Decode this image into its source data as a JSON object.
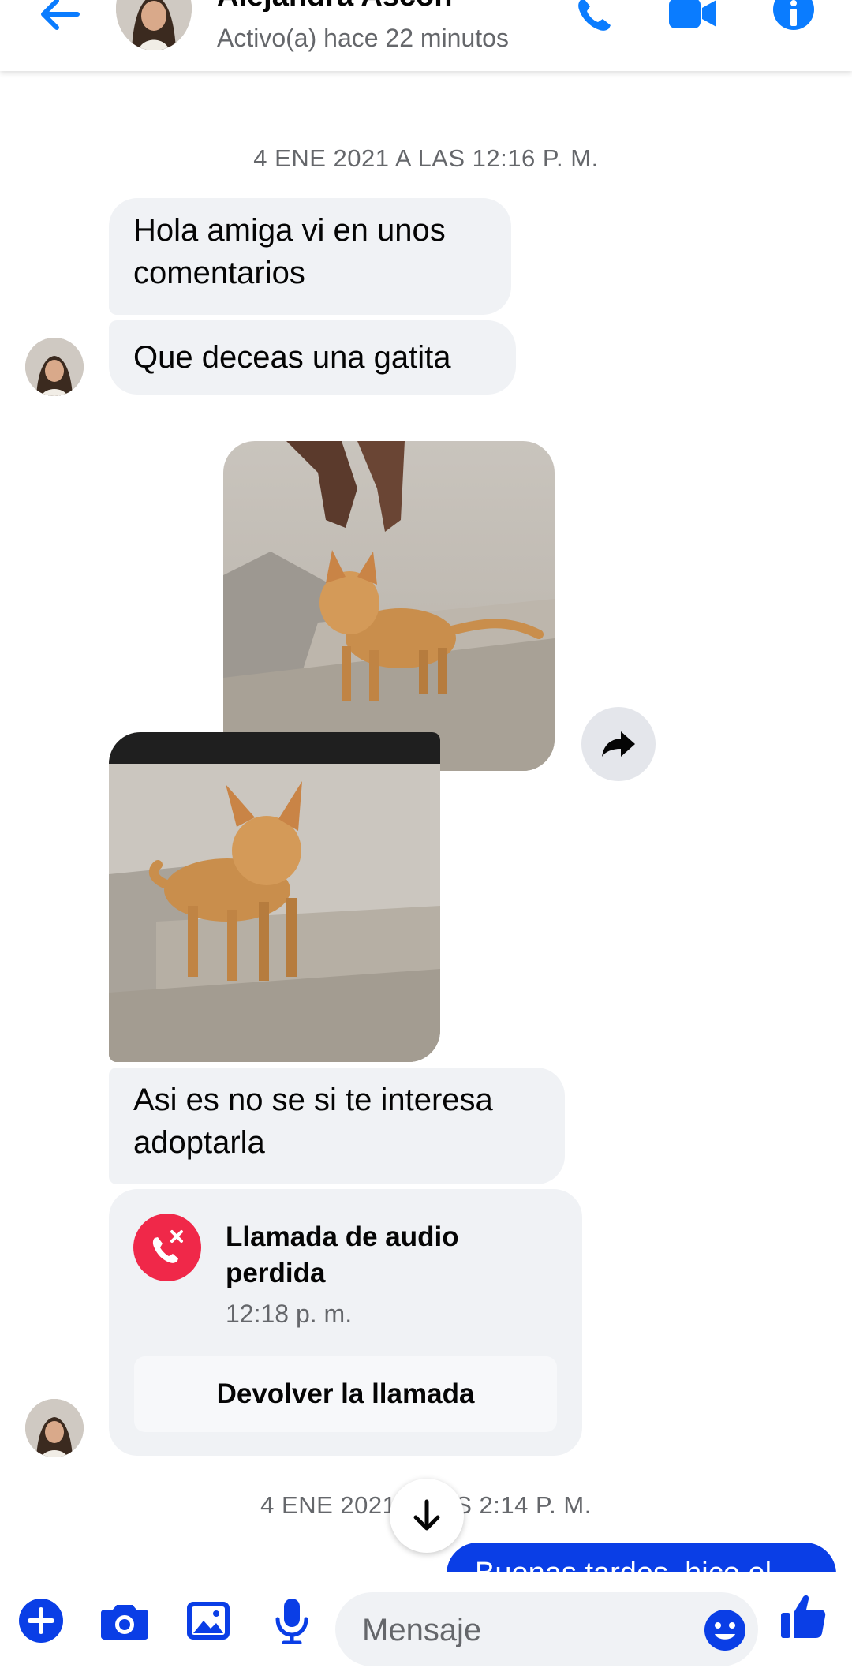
{
  "header": {
    "contact_name": "Alejandra Ascon",
    "status": "Activo(a) hace 22 minutos",
    "icons": [
      "back-arrow-icon",
      "phone-icon",
      "video-camera-icon",
      "info-icon"
    ]
  },
  "conversation": {
    "timestamp_1": "4 ENE 2021 A LAS 12:16 P. M.",
    "messages": [
      {
        "text": "Hola amiga vi en unos comentarios"
      },
      {
        "text": "Que deceas una gatita"
      },
      {
        "text": "Asi es no se si te interesa adoptarla"
      }
    ],
    "missed_call": {
      "title": "Llamada de audio perdida",
      "time": "12:18 p. m.",
      "callback_label": "Devolver la llamada"
    },
    "timestamp_2": "4 ENE 2021 A LAS 2:14 P. M.",
    "outgoing_preview": "Buenas tardes, hice el"
  },
  "composer": {
    "placeholder": "Mensaje",
    "icons": [
      "plus-icon",
      "camera-icon",
      "gallery-icon",
      "microphone-icon",
      "emoji-icon",
      "thumbs-up-icon"
    ]
  },
  "colors": {
    "accent": "#0a7cff",
    "outgoing_bubble": "#0a3ee6",
    "incoming_bubble": "#f0f2f5",
    "missed_call": "#f02849"
  }
}
